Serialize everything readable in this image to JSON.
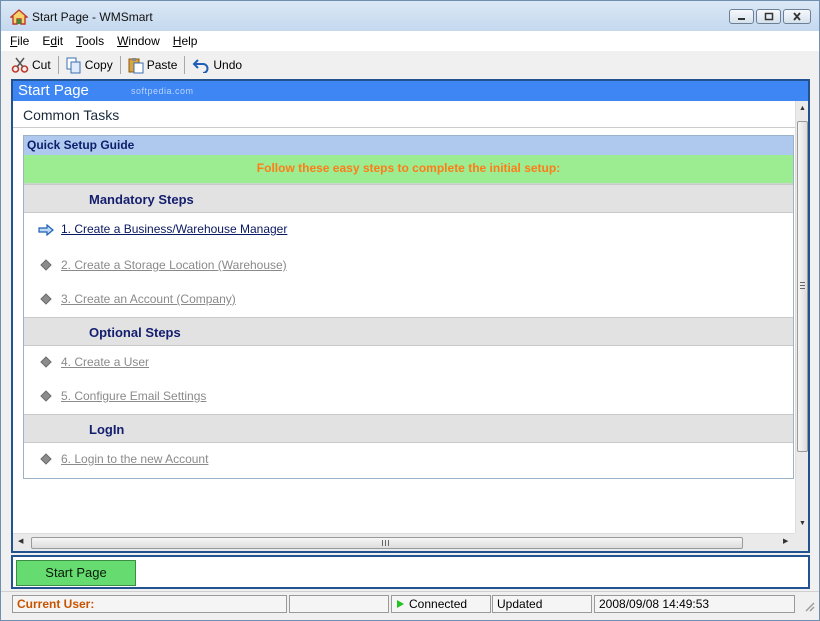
{
  "window": {
    "title": "Start Page - WMSmart",
    "colors": {
      "titlebar": "#c4d8ee",
      "panel_header": "#3d86f4",
      "accent_green": "#66dc70"
    }
  },
  "menu": {
    "items": [
      {
        "label_ul": "F",
        "label_rest": "ile"
      },
      {
        "label_pre": "E",
        "label_ul": "d",
        "label_rest": "it"
      },
      {
        "label_ul": "T",
        "label_rest": "ools"
      },
      {
        "label_ul": "W",
        "label_rest": "indow"
      },
      {
        "label_ul": "H",
        "label_rest": "elp"
      }
    ]
  },
  "toolbar": {
    "cut": "Cut",
    "copy": "Copy",
    "paste": "Paste",
    "undo": "Undo"
  },
  "panel": {
    "header": "Start Page",
    "watermark": "softpedia.com",
    "common_tasks": "Common Tasks"
  },
  "guide": {
    "title": "Quick Setup Guide",
    "instructions": "Follow these easy steps to complete the initial setup:",
    "sections": [
      {
        "header": "Mandatory Steps",
        "steps": [
          {
            "label": "1. Create  a Business/Warehouse Manager",
            "active": true
          },
          {
            "label": "2. Create  a Storage Location (Warehouse)",
            "active": false
          },
          {
            "label": "3. Create an Account (Company)",
            "active": false
          }
        ]
      },
      {
        "header": "Optional Steps",
        "steps": [
          {
            "label": "4. Create a User",
            "active": false
          },
          {
            "label": "5. Configure Email Settings",
            "active": false
          }
        ]
      },
      {
        "header": "LogIn",
        "steps": [
          {
            "label": "6. Login to the new Account",
            "active": false
          }
        ]
      }
    ]
  },
  "tabs": {
    "start_page": "Start Page"
  },
  "status": {
    "current_user": "Current User:",
    "connection": "Connected",
    "updated": "Updated",
    "datetime": "2008/09/08 14:49:53"
  }
}
